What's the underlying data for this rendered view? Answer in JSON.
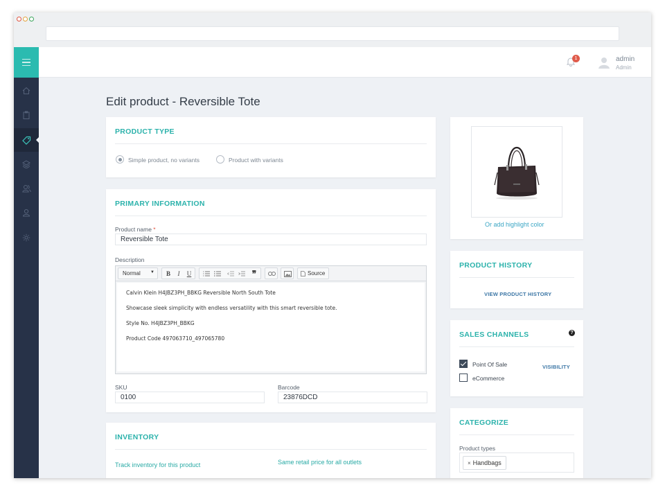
{
  "app": {
    "user": {
      "name": "admin",
      "role": "Admin"
    },
    "notifications_count": "1"
  },
  "page": {
    "title": "Edit product - Reversible Tote"
  },
  "product_type": {
    "title": "PRODUCT TYPE",
    "options": [
      "Simple product, no variants",
      "Product with variants"
    ],
    "selected": "Simple product, no variants"
  },
  "primary": {
    "title": "PRIMARY INFORMATION",
    "name_label": "Product name",
    "required_mark": "*",
    "name_value": "Reversible Tote",
    "description_label": "Description",
    "editor": {
      "format_select": "Normal",
      "bold": "B",
      "italic": "I",
      "underline": "U",
      "quote": "❞",
      "source": "Source"
    },
    "description_lines": [
      "Calvin Klein H4JBZ3PH_BBKG Reversible North South Tote",
      "Showcase sleek simplicity with endless versatility with this smart reversible tote.",
      "Style No. H4JBZ3PH_BBKG",
      "Product Code 497063710_497065780"
    ],
    "sku_label": "SKU",
    "sku_value": "0100",
    "barcode_label": "Barcode",
    "barcode_value": "23876DCD"
  },
  "inventory": {
    "title": "INVENTORY",
    "track_link": "Track inventory for this product",
    "price_link": "Same retail price for all outlets"
  },
  "image_panel": {
    "highlight_link": "Or add highlight color"
  },
  "history": {
    "title": "PRODUCT HISTORY",
    "view_link": "VIEW PRODUCT HISTORY"
  },
  "sales_channels": {
    "title": "SALES CHANNELS",
    "help": "?",
    "channels": [
      {
        "label": "Point Of Sale",
        "checked": true
      },
      {
        "label": "eCommerce",
        "checked": false
      }
    ],
    "visibility_link": "VISIBILITY"
  },
  "categorize": {
    "title": "CATEGORIZE",
    "product_types_label": "Product types",
    "tags": [
      "Handbags"
    ],
    "tag_remove": "×"
  },
  "colors": {
    "accent": "#2bbbb0",
    "sidebar": "#273248",
    "background": "#eef1f5",
    "badge": "#e05b4b"
  },
  "icons": {
    "sidebar": [
      "home-icon",
      "clipboard-icon",
      "tag-icon",
      "layers-icon",
      "users-icon",
      "user-icon",
      "gear-icon"
    ],
    "topbar": [
      "bell-icon",
      "avatar-icon"
    ]
  }
}
